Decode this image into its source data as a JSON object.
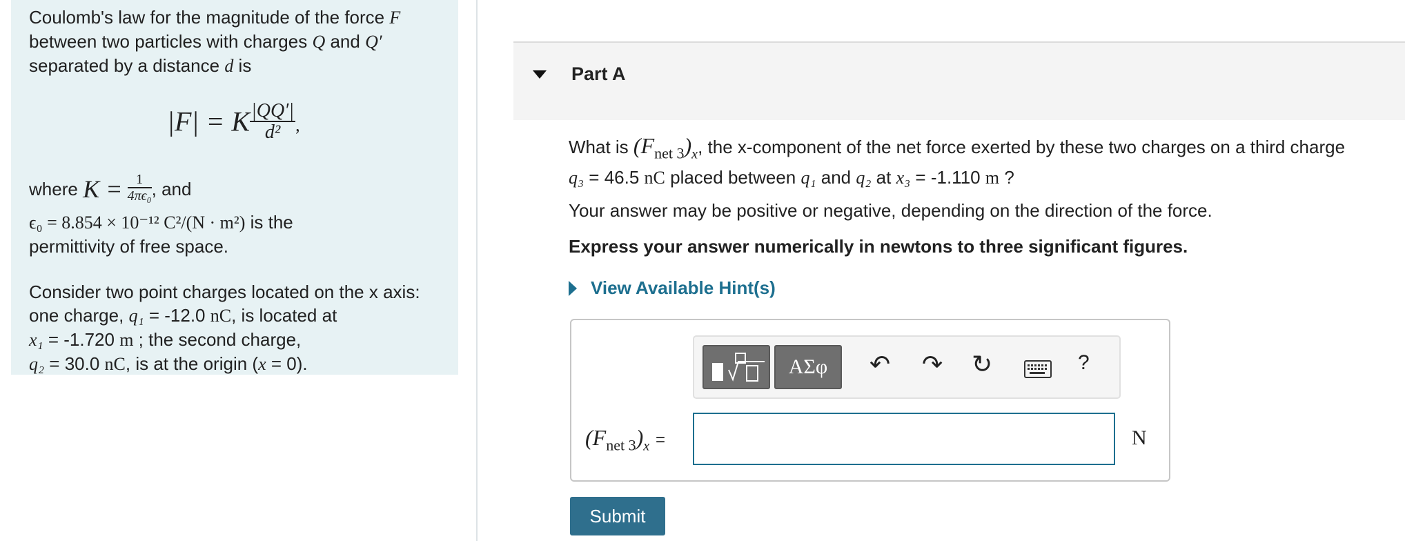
{
  "intro": {
    "text_1": "Coulomb's law for the magnitude of the force",
    "var_F": "F",
    "text_2": "between two particles with charges",
    "var_Q": "Q",
    "text_and": "and",
    "var_Qp": "Q′",
    "text_3": "separated by a distance",
    "var_d": "d",
    "text_is": "is"
  },
  "equation": {
    "lhs": "|F| = K",
    "numerator": "|QQ′|",
    "denominator": "d²",
    "trailing": ","
  },
  "where": {
    "text_where": "where",
    "lhs": "K =",
    "numerator": "1",
    "denominator": "4πϵ₀",
    "text_and": ", and"
  },
  "epsilon": {
    "expr": "ϵ₀ = 8.854 × 10⁻¹² C²/(N · m²)",
    "text_1": "is the",
    "text_2": "permittivity of free space."
  },
  "consider": {
    "line_1": "Consider two point charges located on the x axis:",
    "line_2_a": "one charge,",
    "q1_symbol": "q₁",
    "q1_value": "= -12.0",
    "q1_unit": "nC",
    "line_2_b": ", is located at",
    "x1_symbol": "x₁",
    "x1_value": "= -1.720",
    "x1_unit": "m",
    "line_3_b": "; the second charge,",
    "q2_symbol": "q₂",
    "q2_value": "= 30.0",
    "q2_unit": "nC",
    "line_4_b": ", is at the origin (",
    "origin_var": "x",
    "origin_value": " = 0)."
  },
  "part": {
    "title": "Part A"
  },
  "question": {
    "text_what": "What is",
    "fnet_expr": "(F",
    "fnet_sub": "net 3",
    "fnet_close": ")",
    "fnet_x": "x",
    "text_1": ", the x-component of the net force exerted by these two charges on a third charge",
    "q3_symbol": "q₃",
    "q3_value": "= 46.5",
    "q3_unit": "nC",
    "text_2": "placed between",
    "q1_symbol": "q₁",
    "text_and": "and",
    "q2_symbol": "q₂",
    "text_at": "at",
    "x3_symbol": "x₃",
    "x3_value": "= -1.110",
    "x3_unit": "m",
    "text_end": "?"
  },
  "answer_note": "Your answer may be positive or negative, depending on the direction of the force.",
  "express": "Express your answer numerically in newtons to three significant figures.",
  "hints_label": "View Available Hint(s)",
  "toolbar": {
    "symbols_label": "ΑΣφ",
    "help_label": "?"
  },
  "answer": {
    "label_f": "(F",
    "label_sub": "net 3",
    "label_close": ")",
    "label_x": "x",
    "label_eq": "=",
    "input_value": "",
    "unit": "N"
  },
  "submit_label": "Submit"
}
